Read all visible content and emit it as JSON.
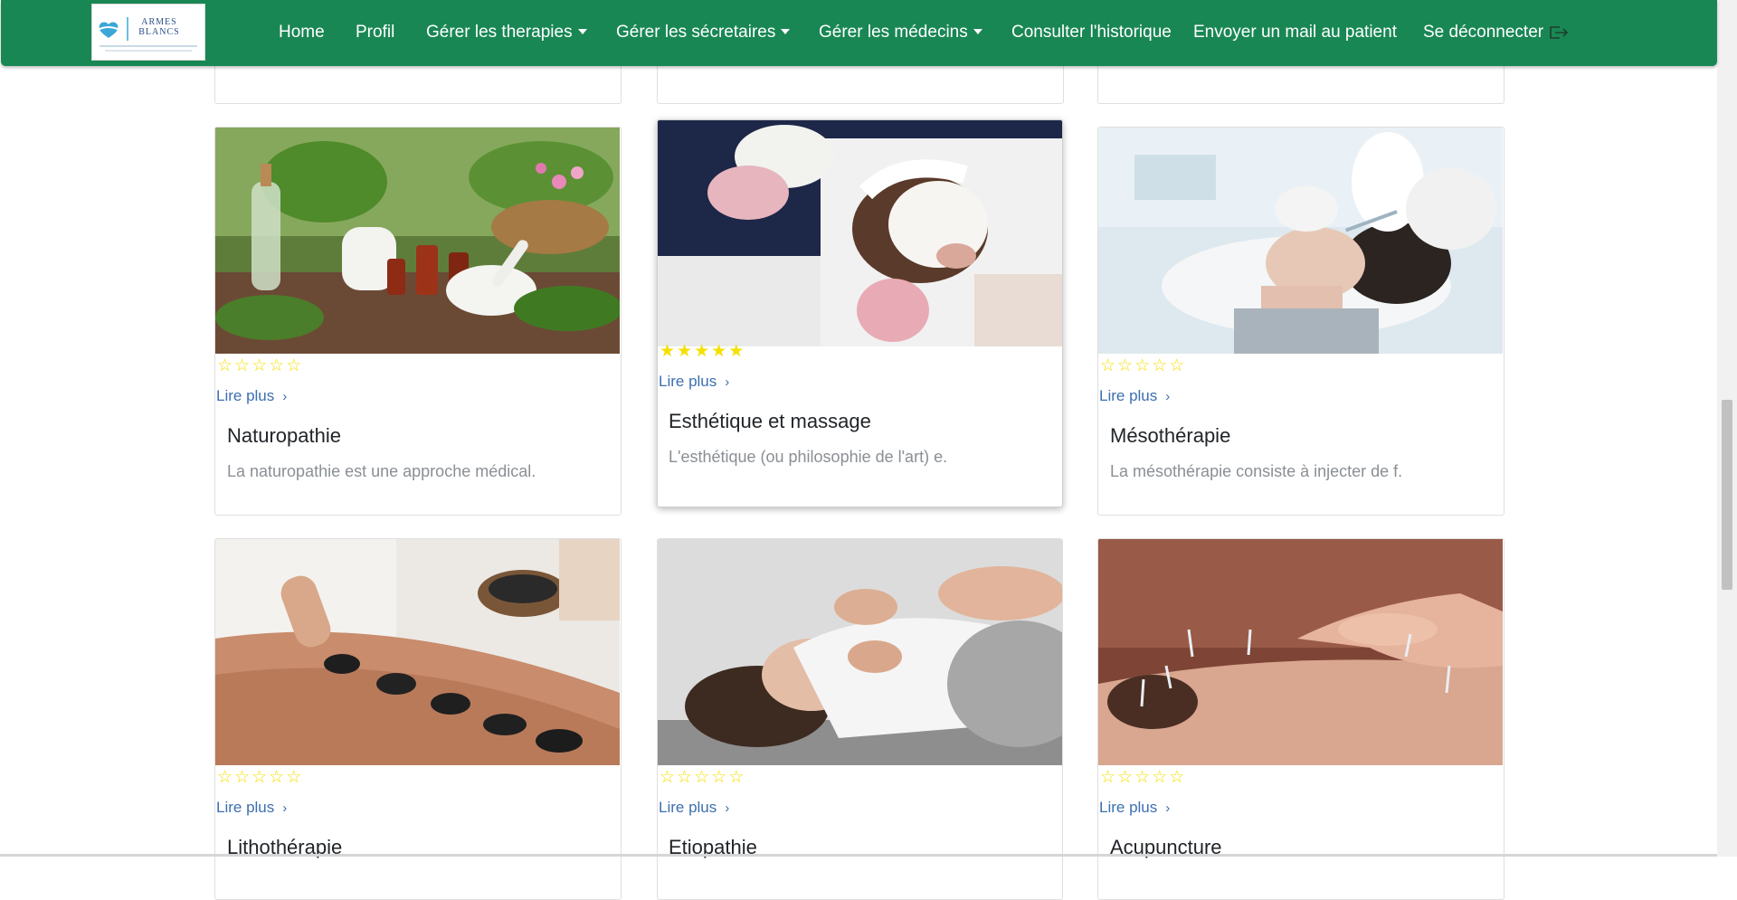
{
  "navbar": {
    "logo_text": "ARMES BLANCS",
    "items": [
      {
        "label": "Home"
      },
      {
        "label": "Profil"
      },
      {
        "label": "Gérer les therapies"
      },
      {
        "label": "Gérer les sécretaires"
      },
      {
        "label": "Gérer les médecins"
      },
      {
        "label": "Consulter l'historique"
      },
      {
        "label": "Envoyer un mail au patient"
      },
      {
        "label": "Se déconnecter"
      }
    ],
    "color": "#198754"
  },
  "cards": [
    {
      "title": "Naturopathie",
      "text": "La naturopathie est une approche médical.",
      "rating": 0,
      "link": "Lire plus"
    },
    {
      "title": "Esthétique et massage",
      "text": "L'esthétique (ou philosophie de l'art) e.",
      "rating": 5,
      "link": "Lire plus"
    },
    {
      "title": "Mésothérapie",
      "text": "La mésothérapie consiste à injecter de f.",
      "rating": 0,
      "link": "Lire plus"
    },
    {
      "title": "Lithothérapie",
      "text": "",
      "rating": 0,
      "link": "Lire plus"
    },
    {
      "title": "Etiopathie",
      "text": "",
      "rating": 0,
      "link": "Lire plus"
    },
    {
      "title": "Acupuncture",
      "text": "",
      "rating": 0,
      "link": "Lire plus"
    }
  ],
  "colors": {
    "star": "#f5e000",
    "link": "#3b6fb0",
    "muted_text": "#8a8f94"
  }
}
